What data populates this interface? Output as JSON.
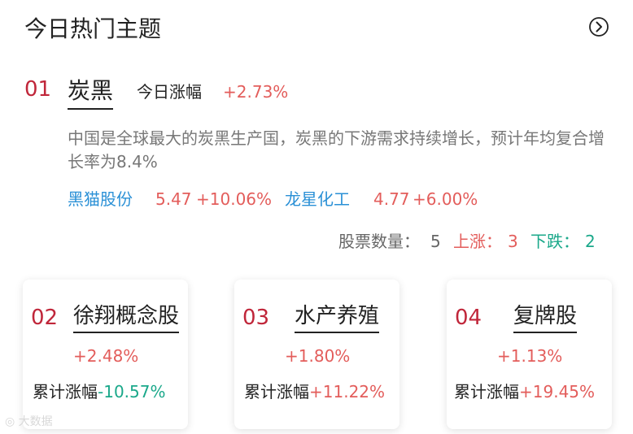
{
  "header": {
    "title": "今日热门主题",
    "more_icon": "circle-chevron-right-icon"
  },
  "top_topic": {
    "rank": "01",
    "name": "炭黑",
    "today_label": "今日涨幅",
    "today_change": "+2.73%",
    "description": "中国是全球最大的炭黑生产国，炭黑的下游需求持续增长，预计年均复合增长率为8.4%",
    "stocks": [
      {
        "name": "黑猫股份",
        "price": "5.47",
        "change": "+10.06%"
      },
      {
        "name": "龙星化工",
        "price": "4.77",
        "change": "+6.00%"
      }
    ],
    "counts": {
      "total_label": "股票数量：",
      "total": "5",
      "up_label": "上涨：",
      "up": "3",
      "down_label": "下跌：",
      "down": "2"
    }
  },
  "cards": [
    {
      "rank": "02",
      "name": "徐翔概念股",
      "change": "+2.48%",
      "total_label": "累计涨幅",
      "total": "-10.57%"
    },
    {
      "rank": "03",
      "name": "水产养殖",
      "change": "+1.80%",
      "total_label": "累计涨幅",
      "total": "+11.22%"
    },
    {
      "rank": "04",
      "name": "复牌股",
      "change": "+1.13%",
      "total_label": "累计涨幅",
      "total": "+19.45%"
    }
  ],
  "watermark": "大数据",
  "colors": {
    "rank": "#c0263a",
    "up": "#e35d5b",
    "down": "#1aa88a",
    "link": "#2a90d6"
  }
}
